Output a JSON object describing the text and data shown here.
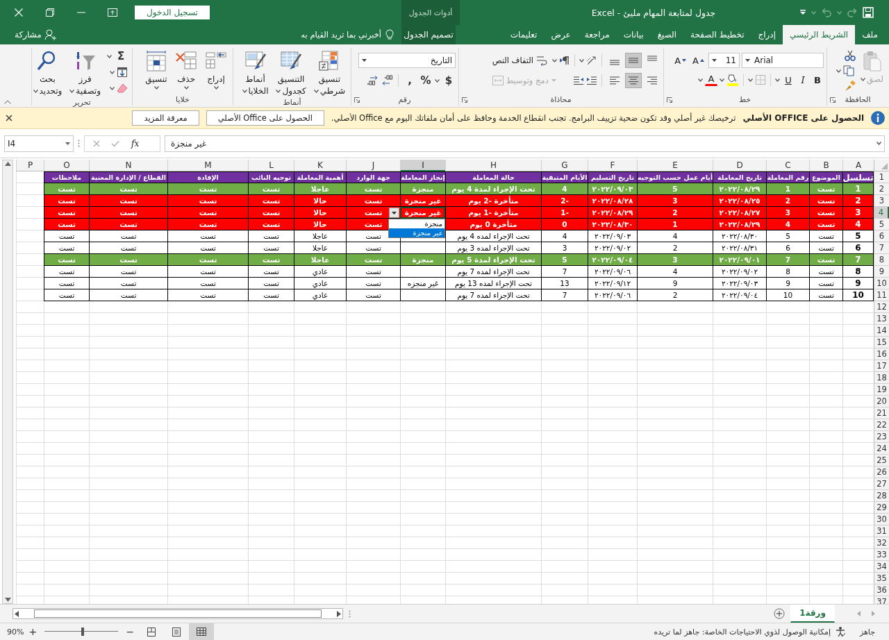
{
  "title_bar": {
    "title": "جدول لمتابعة المهام مليئ - Excel",
    "context_label": "أدوات الجدول",
    "sign_in": "تسجيل الدخول"
  },
  "ribbon_tabs": [
    {
      "label": "ملف",
      "selected": false,
      "kind": "tab"
    },
    {
      "label": "الشريط الرئيسي",
      "selected": true,
      "kind": "tab"
    },
    {
      "label": "إدراج",
      "selected": false,
      "kind": "tab"
    },
    {
      "label": "تخطيط الصفحة",
      "selected": false,
      "kind": "tab"
    },
    {
      "label": "الصيغ",
      "selected": false,
      "kind": "tab"
    },
    {
      "label": "بيانات",
      "selected": false,
      "kind": "tab"
    },
    {
      "label": "مراجعة",
      "selected": false,
      "kind": "tab"
    },
    {
      "label": "عرض",
      "selected": false,
      "kind": "tab"
    },
    {
      "label": "تعليمات",
      "selected": false,
      "kind": "tab"
    },
    {
      "label": "تصميم الجدول",
      "selected": false,
      "kind": "context"
    }
  ],
  "tell_me": "أخبرني بما تريد القيام به",
  "share": "مشاركة",
  "ribbon": {
    "clipboard": {
      "label": "الحافظة",
      "paste": {
        "label": "لصق",
        "disabled": true
      }
    },
    "font": {
      "label": "خط",
      "font_name": "Arial",
      "font_size": "11",
      "grow": "A",
      "shrink": "A",
      "style_buttons": [
        "B",
        "I",
        "U"
      ],
      "font_color": "A"
    },
    "alignment": {
      "label": "محاذاة",
      "vertical": [
        {
          "kind": "top",
          "pressed": false
        },
        {
          "kind": "middle",
          "pressed": true
        },
        {
          "kind": "bottom",
          "pressed": false
        }
      ],
      "horizontal": [
        {
          "kind": "right",
          "pressed": false
        },
        {
          "kind": "center",
          "pressed": true
        },
        {
          "kind": "left",
          "pressed": false
        }
      ],
      "wrap_text": "التفاف النص",
      "merge": {
        "label": "دمج وتوسيط",
        "disabled": true
      }
    },
    "number": {
      "label": "رقم",
      "format": "التاريخ",
      "symbols": [
        "$",
        "%",
        ","
      ]
    },
    "styles": {
      "label": "أنماط",
      "buttons": [
        {
          "kind": "conditional",
          "lines": [
            "تنسيق",
            "شرطي"
          ]
        },
        {
          "kind": "table",
          "lines": [
            "التنسيق",
            "كجدول"
          ]
        },
        {
          "kind": "cell_styles",
          "lines": [
            "أنماط",
            "الخلايا"
          ]
        }
      ]
    },
    "cells": {
      "label": "خلايا",
      "buttons": [
        {
          "kind": "insert",
          "label": "إدراج"
        },
        {
          "kind": "delete",
          "label": "حذف"
        },
        {
          "kind": "format",
          "label": "تنسيق"
        }
      ]
    },
    "editing": {
      "label": "تحرير",
      "sum": "Σ",
      "buttons": [
        {
          "kind": "sort",
          "lines": [
            "فرز",
            "وتصفية"
          ]
        },
        {
          "kind": "find",
          "lines": [
            "بحث",
            "وتحديد"
          ]
        }
      ]
    }
  },
  "message_bar": {
    "title": "الحصول على OFFICE الأصلي",
    "text": "ترخيصك غير أصلي وقد تكون ضحية تزييف البرامج. تجنب انقطاع الخدمة وحافظ على أمان ملفاتك اليوم مع Office الأصلي.",
    "buttons": [
      "الحصول على Office الأصلي",
      "معرفة المزيد"
    ]
  },
  "formula_bar": {
    "name_box": "I4",
    "fx": "fx",
    "formula": "غير منجزة"
  },
  "sheet": {
    "columns": [
      {
        "label": "A",
        "selected": false
      },
      {
        "label": "B",
        "selected": false
      },
      {
        "label": "C",
        "selected": false
      },
      {
        "label": "D",
        "selected": false
      },
      {
        "label": "E",
        "selected": false
      },
      {
        "label": "F",
        "selected": false
      },
      {
        "label": "G",
        "selected": false
      },
      {
        "label": "H",
        "selected": false
      },
      {
        "label": "I",
        "selected": true
      },
      {
        "label": "J",
        "selected": false
      },
      {
        "label": "K",
        "selected": false
      },
      {
        "label": "L",
        "selected": false
      },
      {
        "label": "M",
        "selected": false
      },
      {
        "label": "N",
        "selected": false
      },
      {
        "label": "O",
        "selected": false
      },
      {
        "label": "P",
        "selected": false
      }
    ],
    "row_headers": [
      {
        "label": "1",
        "selected": false
      },
      {
        "label": "2",
        "selected": false
      },
      {
        "label": "3",
        "selected": false
      },
      {
        "label": "4",
        "selected": true
      },
      {
        "label": "5",
        "selected": false
      },
      {
        "label": "6",
        "selected": false
      },
      {
        "label": "7",
        "selected": false
      },
      {
        "label": "8",
        "selected": false
      },
      {
        "label": "9",
        "selected": false
      },
      {
        "label": "10",
        "selected": false
      },
      {
        "label": "11",
        "selected": false
      },
      {
        "label": "12",
        "selected": false
      },
      {
        "label": "13",
        "selected": false
      },
      {
        "label": "14",
        "selected": false
      },
      {
        "label": "15",
        "selected": false
      },
      {
        "label": "16",
        "selected": false
      },
      {
        "label": "17",
        "selected": false
      },
      {
        "label": "18",
        "selected": false
      },
      {
        "label": "19",
        "selected": false
      },
      {
        "label": "20",
        "selected": false
      },
      {
        "label": "21",
        "selected": false
      },
      {
        "label": "22",
        "selected": false
      },
      {
        "label": "23",
        "selected": false
      },
      {
        "label": "24",
        "selected": false
      },
      {
        "label": "25",
        "selected": false
      },
      {
        "label": "26",
        "selected": false
      },
      {
        "label": "27",
        "selected": false
      },
      {
        "label": "28",
        "selected": false
      },
      {
        "label": "29",
        "selected": false
      },
      {
        "label": "30",
        "selected": false
      },
      {
        "label": "31",
        "selected": false
      },
      {
        "label": "32",
        "selected": false
      },
      {
        "label": "33",
        "selected": false
      },
      {
        "label": "34",
        "selected": false
      },
      {
        "label": "35",
        "selected": false
      },
      {
        "label": "36",
        "selected": false
      },
      {
        "label": "37",
        "selected": false
      }
    ],
    "rows": [
      {
        "kind": "header",
        "cells": [
          "تسلسل",
          "الموضوع",
          "رقم المعاملة",
          "تاريخ المعاملة",
          "أيام عمل حسب التوجيه",
          "تاريخ التسليم",
          "الأيام المتبقية",
          "حالة المعاملة",
          "إنجاز المعاملة",
          "جهة الوارد",
          "أهمية المعاملة",
          "توجيه النائب",
          "الإفادة",
          "القطاع / الإدارة المعنية",
          "ملاحظات"
        ]
      },
      {
        "kind": "done",
        "cells": [
          "1",
          "تست",
          "1",
          "٢٠٢٢/٠٨/٢٩",
          "5",
          "٢٠٢٢/٠٩/٠٣",
          "4",
          "تحت الإجراء لمدة 4 يوم",
          "منجزة",
          "تست",
          "عاجلا",
          "تست",
          "تست",
          "تست",
          "تست"
        ]
      },
      {
        "kind": "late",
        "cells": [
          "2",
          "تست",
          "2",
          "٢٠٢٢/٠٨/٢٥",
          "3",
          "٢٠٢٢/٠٨/٢٨",
          "-2",
          "متأخرة -2 يوم",
          "غير منجزة",
          "تست",
          "حالا",
          "تست",
          "تست",
          "تست",
          "تست"
        ]
      },
      {
        "kind": "late",
        "cells": [
          "3",
          "تست",
          "3",
          "٢٠٢٢/٠٨/٢٧",
          "2",
          "٢٠٢٢/٠٨/٢٩",
          "-1",
          "متأخرة -1 يوم",
          "غير منجزة",
          "تست",
          "حالا",
          "تست",
          "تست",
          "تست",
          "تست"
        ]
      },
      {
        "kind": "late",
        "cells": [
          "4",
          "تست",
          "4",
          "٢٠٢٢/٠٨/٢٩",
          "1",
          "٢٠٢٢/٠٨/٣٠",
          "0",
          "متأخرة 0 يوم",
          null,
          "تست",
          "حالا",
          "تست",
          "تست",
          "تست",
          "تست"
        ]
      },
      {
        "kind": "normal",
        "cells": [
          "5",
          "تست",
          "5",
          "٢٠٢٢/٠٨/٣٠",
          "4",
          "٢٠٢٢/٠٩/٠٣",
          "4",
          "تحت الإجراء لمده 4 يوم",
          null,
          "تست",
          "عاجلا",
          "تست",
          "تست",
          "تست",
          "تست"
        ]
      },
      {
        "kind": "normal",
        "cells": [
          "6",
          "تست",
          "6",
          "٢٠٢٢/٠٨/٣١",
          "2",
          "٢٠٢٢/٠٩/٠٢",
          "3",
          "تحت الإجراء لمده 3 يوم",
          null,
          "تست",
          "عاجلا",
          "تست",
          "تست",
          "تست",
          "تست"
        ]
      },
      {
        "kind": "done",
        "cells": [
          "7",
          "تست",
          "7",
          "٢٠٢٢/٠٩/٠١",
          "3",
          "٢٠٢٢/٠٩/٠٤",
          "5",
          "تحت الإجراء لمدة 5 يوم",
          "منجزة",
          "تست",
          "عاجلا",
          "تست",
          "تست",
          "تست",
          "تست"
        ]
      },
      {
        "kind": "normal",
        "cells": [
          "8",
          "تست",
          "8",
          "٢٠٢٢/٠٩/٠٢",
          "4",
          "٢٠٢٢/٠٩/٠٦",
          "7",
          "تحت الإجراء لمده 7 يوم",
          null,
          "تست",
          "عادي",
          "تست",
          "تست",
          "تست",
          "تست"
        ]
      },
      {
        "kind": "normal",
        "cells": [
          "9",
          "تست",
          "9",
          "٢٠٢٢/٠٩/٠٣",
          "9",
          "٢٠٢٢/٠٩/١٢",
          "13",
          "تحت الإجراء لمده 13 يوم",
          "غير منجزه",
          "تست",
          "عادي",
          "تست",
          "تست",
          "تست",
          "تست"
        ]
      },
      {
        "kind": "normal",
        "cells": [
          "10",
          "تست",
          "10",
          "٢٠٢٢/٠٩/٠٤",
          "2",
          "٢٠٢٢/٠٩/٠٦",
          "7",
          "تحت الإجراء لمده 7 يوم",
          null,
          "تست",
          "عادي",
          "تست",
          "تست",
          "تست",
          "تست"
        ]
      }
    ],
    "dropdown": [
      {
        "label": "منجزة",
        "selected": false
      },
      {
        "label": "غير منجزة",
        "selected": true
      }
    ]
  },
  "sheet_tabs": [
    {
      "label": "ورقة1",
      "selected": true
    }
  ],
  "status_bar": {
    "ready": "جاهز",
    "accessibility": "إمكانية الوصول لذوي الاحتياجات الخاصة: جاهز لما تريده",
    "views": [
      {
        "kind": "normal",
        "selected": true
      },
      {
        "kind": "page_layout",
        "selected": false
      },
      {
        "kind": "page_break",
        "selected": false
      }
    ],
    "zoom": {
      "minus": "−",
      "plus": "+",
      "level": 0.49,
      "label": "90%"
    }
  }
}
